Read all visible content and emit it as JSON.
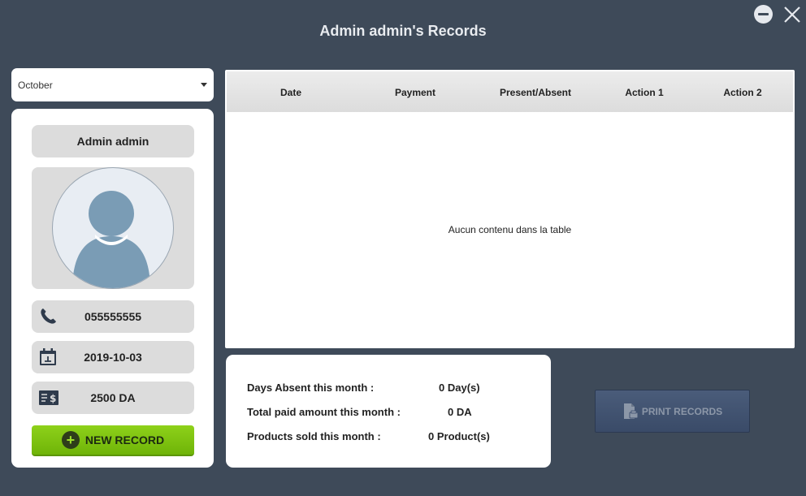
{
  "window": {
    "title": "Admin admin's Records"
  },
  "month_select": {
    "value": "October"
  },
  "profile": {
    "name": "Admin admin",
    "phone": "055555555",
    "date": "2019-10-03",
    "amount": "2500 DA",
    "new_record_label": "NEW RECORD"
  },
  "table": {
    "columns": [
      "Date",
      "Payment",
      "Present/Absent",
      "Action 1",
      "Action 2"
    ],
    "rows": [],
    "empty_message": "Aucun contenu dans la table"
  },
  "stats": {
    "days_absent_label": "Days Absent this month :",
    "days_absent_value": "0 Day(s)",
    "total_paid_label": "Total paid amount this month :",
    "total_paid_value": "0 DA",
    "products_sold_label": "Products sold this month :",
    "products_sold_value": "0 Product(s)"
  },
  "print_button": {
    "label": "PRINT RECORDS"
  },
  "colors": {
    "background": "#3e4a59",
    "accent_green": "#7fc210",
    "print_button": "#415271",
    "avatar_silhouette": "#7a9cb5"
  },
  "icons": [
    "minimize-icon",
    "close-icon",
    "dropdown-caret-icon",
    "phone-icon",
    "calendar-icon",
    "money-icon",
    "plus-icon",
    "print-document-icon"
  ]
}
